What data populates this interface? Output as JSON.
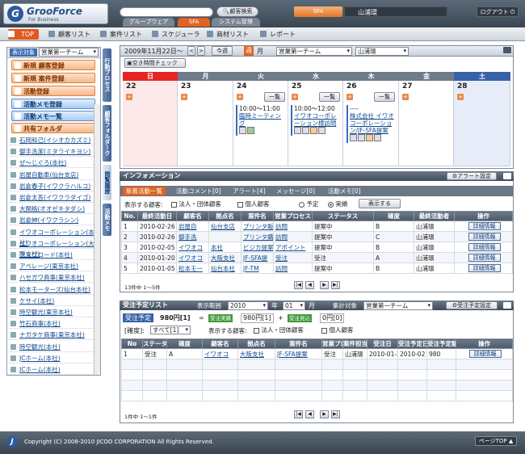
{
  "header": {
    "logo_title": "GrooForce",
    "logo_sub": "For Business",
    "search_button": "顧客検索",
    "tab_groupware": "グループウェア",
    "tab_sfa": "SFA",
    "tab_system": "システム管理",
    "sfa_badge": "SFA",
    "user_name": "山浦環",
    "logout": "ログアウト"
  },
  "nav": {
    "items": [
      "TOP",
      "顧客リスト",
      "案件リスト",
      "スケジューラ",
      "商材リスト",
      "レポート"
    ]
  },
  "sidebar": {
    "target_label": "表示対象",
    "team_select": "営業第一チーム",
    "buttons": [
      "新規 顧客登録",
      "新規 案件登録",
      "活動登録",
      "活動メモ登録",
      "活動メモ一覧",
      "共有フォルダ"
    ],
    "customers": [
      "石岡和己(イシオカカズミ)",
      "御手洗潔(ミタライキヨシ)",
      "ぜ～じぐろ(本社)",
      "岩屋自動車(仙台支店)",
      "岩倉春子(イワクラハルコ)",
      "岩倉太吾(イワクラダイゴ)",
      "大関格(オオゼキタダシ)",
      "岩倉紳(イワクラシン)",
      "イワオコーポレーション(本社)",
      "イワオコーポレーション(大阪支社)",
      "アップロード(本社)",
      "アベレージ(東京本社)",
      "ハセガワ商事(東京本社)",
      "松本モーターズ(仙台本社)",
      "ケサイ(本社)",
      "時空観光(東京本社)",
      "竹石商事(本社)",
      "ナガタケ商事(東京本社)",
      "時空観光(本社)",
      "JCホーム(本社)",
      "JCホーム(本社)"
    ],
    "vtabs": [
      "行動プロセス",
      "顧客フォルダーク",
      "閲覧履歴",
      "活動メモ"
    ]
  },
  "calendar": {
    "date": "2009年11月22日～",
    "today_button": "今週",
    "week_label": "週",
    "month_label": "月",
    "team": "営業第一チーム",
    "user": "山浦環",
    "free_check": "空き時間チェック",
    "days": [
      "日",
      "月",
      "火",
      "水",
      "木",
      "金",
      "土"
    ],
    "dates": [
      "22",
      "23",
      "24",
      "25",
      "26",
      "27",
      "28"
    ],
    "list_label": "一覧",
    "events": {
      "tue": {
        "time": "10:00～11:00",
        "title": "臨時ミーティング"
      },
      "wed": {
        "time": "10:00～12:00",
        "title": "イワオコーポレーション様訪問"
      },
      "thu": {
        "time": "----",
        "title": "株式会社 イワオコーポレーション/JF-SFA提案"
      }
    }
  },
  "info": {
    "title": "インフォメーション",
    "alert_button": "アラート設定",
    "tabs": [
      "新着活動一覧",
      "活動コメント[0]",
      "アラート[4]",
      "メッセージ[0]",
      "活動メモ[0]"
    ],
    "filter_label": "表示する顧客:",
    "filter_corp": "法人・団体顧客",
    "filter_indiv": "個人顧客",
    "radio_plan": "予定",
    "radio_done": "実績",
    "show_button": "表示する",
    "columns": [
      "No.",
      "最終活動日",
      "顧客名",
      "拠点名",
      "案件名",
      "営業プロセス",
      "ステータス",
      "確度",
      "最終活動者",
      "操作"
    ],
    "rows": [
      [
        "1",
        "2010-02-26",
        "岩屋自",
        "仙台支店",
        "プリンタ販売",
        "訪問",
        "提案中",
        "B",
        "山浦環",
        "詳細情報"
      ],
      [
        "2",
        "2010-02-26",
        "御手洗",
        "",
        "プリンタ購入",
        "訪問",
        "提案中",
        "C",
        "山浦環",
        "詳細情報"
      ],
      [
        "3",
        "2010-02-05",
        "イワオコ",
        "本社",
        "ビジカ提案",
        "アポイント",
        "提案中",
        "B",
        "山浦環",
        "詳細情報"
      ],
      [
        "4",
        "2010-01-20",
        "イワオコ",
        "大阪支社",
        "JF-SFA提",
        "受注",
        "受注",
        "A",
        "山浦環",
        "詳細情報"
      ],
      [
        "5",
        "2010-01-05",
        "松本モー",
        "仙台本社",
        "JF-TM",
        "訪問",
        "提案中",
        "B",
        "山浦環",
        "詳細情報"
      ]
    ],
    "count": "13件中 1～5件"
  },
  "orders": {
    "title": "受注予定リスト",
    "range_label": "表示範囲",
    "year": "2010",
    "year_unit": "年",
    "month": "01",
    "month_unit": "月",
    "agg_label": "集計対象",
    "team": "営業第一チーム",
    "settings_button": "受注予定設定",
    "summary_label": "受注予定",
    "summary_value": "980円[1]",
    "eq": "=",
    "actual_label": "受注実績",
    "actual_value": "980円[1]",
    "plus": "+",
    "forecast_label": "受注見込",
    "forecast_value": "0円[0]",
    "accuracy_label": "[確度]:",
    "accuracy_value": "すべて[1]",
    "filter_label": "表示する顧客:",
    "filter_corp": "法人・団体顧客",
    "filter_indiv": "個人顧客",
    "columns": [
      "No",
      "ステータス",
      "確度",
      "顧客名",
      "拠点名",
      "案件名",
      "営業プロセス",
      "案件担当者",
      "受注日",
      "受注予定日",
      "受注予定額",
      "操作"
    ],
    "rows": [
      [
        "1",
        "受注",
        "A",
        "イワオコ",
        "大阪支社",
        "JF-SFA提案",
        "受注",
        "山浦環",
        "2010-01-20",
        "2010-02",
        "980",
        "詳細情報"
      ]
    ],
    "count": "1件中 1～1件"
  },
  "footer": {
    "copyright": "Copyright (C) 2008-2010 JICOO CORPORATION All Rights Reserved.",
    "page_top": "ページTOP"
  }
}
